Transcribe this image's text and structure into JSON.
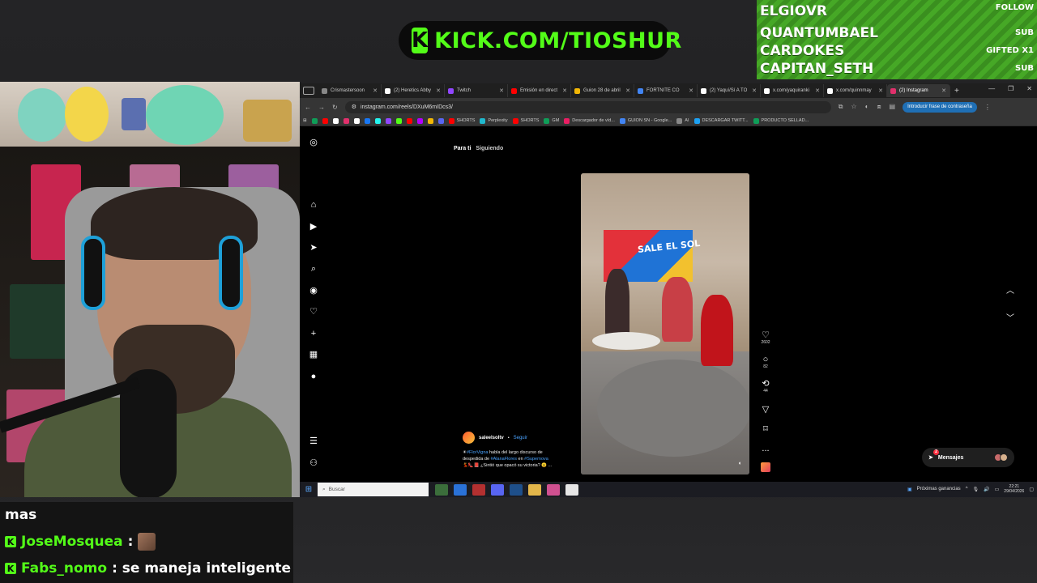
{
  "overlay": {
    "kick_logo_letter": "K",
    "kick_url": "KICK.COM/TIOSHUR",
    "brand_color": "#53fc18",
    "alerts": [
      {
        "name": "ELGIOVR",
        "tag": "FOLLOW"
      },
      {
        "name": "QUANTUMBAEL",
        "tag": "SUB"
      },
      {
        "name": "CARDOKES",
        "tag": "GIFTED X1"
      },
      {
        "name": "CAPITAN_SETH",
        "tag": "SUB"
      }
    ]
  },
  "chat": {
    "badge": "K",
    "lines": [
      {
        "user": "",
        "message": "mas"
      },
      {
        "user": "JoseMosquea",
        "message": ":"
      },
      {
        "user": "Fabs_nomo",
        "message": ": se maneja inteligente"
      }
    ]
  },
  "browser": {
    "tabs": [
      {
        "label": "Crismastersoon",
        "color": "#888888",
        "active": false
      },
      {
        "label": "(2) Heretics Abby",
        "color": "#ffffff",
        "active": false
      },
      {
        "label": "Twitch",
        "color": "#9146ff",
        "active": false
      },
      {
        "label": "Emisión en direct",
        "color": "#ff0000",
        "active": false
      },
      {
        "label": "Guion 28 de abril",
        "color": "#f2b705",
        "active": false
      },
      {
        "label": "FORTNITE CO",
        "color": "#4285f4",
        "active": false
      },
      {
        "label": "(2) Yaquí/Sí A TO",
        "color": "#ffffff",
        "active": false
      },
      {
        "label": "x.com/yaquiranki",
        "color": "#ffffff",
        "active": false
      },
      {
        "label": "x.com/quinnmay",
        "color": "#ffffff",
        "active": false
      },
      {
        "label": "(2) Instagram",
        "color": "#e1306c",
        "active": true
      }
    ],
    "new_tab": "+",
    "url": "instagram.com/reels/DXuM6mIDcs3/",
    "password_button": "Introducir frase de contraseña",
    "bookmarks": [
      {
        "label": "",
        "color": "#0f9d58"
      },
      {
        "label": "",
        "color": "#ff0000"
      },
      {
        "label": "",
        "color": "#ffffff"
      },
      {
        "label": "",
        "color": "#e1306c"
      },
      {
        "label": "",
        "color": "#ffffff"
      },
      {
        "label": "",
        "color": "#1877f2"
      },
      {
        "label": "",
        "color": "#25f4ee"
      },
      {
        "label": "",
        "color": "#9146ff"
      },
      {
        "label": "",
        "color": "#53fc18"
      },
      {
        "label": "",
        "color": "#ff0000"
      },
      {
        "label": "",
        "color": "#b200ff"
      },
      {
        "label": "",
        "color": "#f2b705"
      },
      {
        "label": "",
        "color": "#5865f2"
      },
      {
        "label": "SHORTS",
        "color": "#ff0000"
      },
      {
        "label": "Perplexity",
        "color": "#20b8cd"
      },
      {
        "label": "SHORTS",
        "color": "#ff0000"
      },
      {
        "label": "GM",
        "color": "#0f9d58"
      },
      {
        "label": "Descargador de víd...",
        "color": "#e91e63"
      },
      {
        "label": "GUION SN - Google...",
        "color": "#4285f4"
      },
      {
        "label": "AI",
        "color": "#888888"
      },
      {
        "label": "DESCARGAR TWITT...",
        "color": "#1da1f2"
      },
      {
        "label": "PRODUCTO SELLAD...",
        "color": "#0f9d58"
      }
    ]
  },
  "instagram": {
    "feed_tabs": [
      "Para ti",
      "Siguiendo"
    ],
    "reel_sign": "SALE EL SOL",
    "likes": "2602",
    "comments": "82",
    "reposts": "44",
    "more": "...",
    "author": "saleelsoltv",
    "follow": "Seguir",
    "caption_line1_pre": "☀",
    "caption_tag1": "#FlorVigna",
    "caption_line1_post": " habla del largo discurso de",
    "caption_line2_pre": "despedida de ",
    "caption_tag2": "#AlanaFlores",
    "caption_line2_mid": " en ",
    "caption_tag3": "#Supernova",
    "caption_line3": "💃👠📕 ¿Sintió que opacó su victoria? 😮 ...",
    "messages_label": "Mensajes",
    "messages_badge": "2"
  },
  "taskbar": {
    "search_placeholder": "Buscar",
    "weather": "Próximas ganancias",
    "time": "22:21",
    "date": "29/04/2026"
  }
}
